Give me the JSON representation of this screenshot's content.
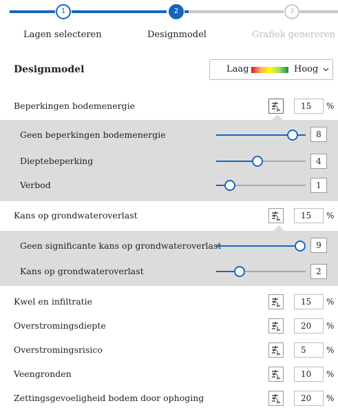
{
  "stepper": {
    "steps": [
      {
        "number": "1",
        "label": "Lagen selecteren",
        "state": "done"
      },
      {
        "number": "2",
        "label": "Designmodel",
        "state": "active"
      },
      {
        "number": "3",
        "label": "Grafiek genereren",
        "state": "todo"
      }
    ],
    "colors": {
      "active": "#1565c0",
      "inactive": "#c8c8c8"
    }
  },
  "header": {
    "title": "Designmodel",
    "legend": {
      "low": "Laag",
      "high": "Hoog",
      "icon": "chevron-down-icon"
    }
  },
  "criteria": [
    {
      "label": "Beperkingen bodemenergie",
      "weight": "15",
      "unit": "%",
      "expanded": true,
      "classes": [
        {
          "label": "Geen beperkingen bodemenergie",
          "value": "8",
          "level": 0.9
        },
        {
          "label": "Dieptebeperking",
          "value": "4",
          "level": 0.45
        },
        {
          "label": "Verbod",
          "value": "1",
          "level": 0.15
        }
      ]
    },
    {
      "label": "Kans op grondwateroverlast",
      "weight": "15",
      "unit": "%",
      "expanded": true,
      "classes": [
        {
          "label": "Geen significante kans op grondwateroverlast",
          "value": "9",
          "level": 0.99
        },
        {
          "label": "Kans op grondwateroverlast",
          "value": "2",
          "level": 0.25
        }
      ]
    },
    {
      "label": "Kwel en infiltratie",
      "weight": "15",
      "unit": "%"
    },
    {
      "label": "Overstromingsdiepte",
      "weight": "20",
      "unit": "%"
    },
    {
      "label": "Overstromingsrisico",
      "weight": "5",
      "unit": "%"
    },
    {
      "label": "Veengronden",
      "weight": "10",
      "unit": "%"
    },
    {
      "label": "Zettingsgevoeligheid bodem door ophoging",
      "weight": "20",
      "unit": "%"
    }
  ],
  "slider_color": "#1565c0",
  "panel_color": "#dcdcdc"
}
